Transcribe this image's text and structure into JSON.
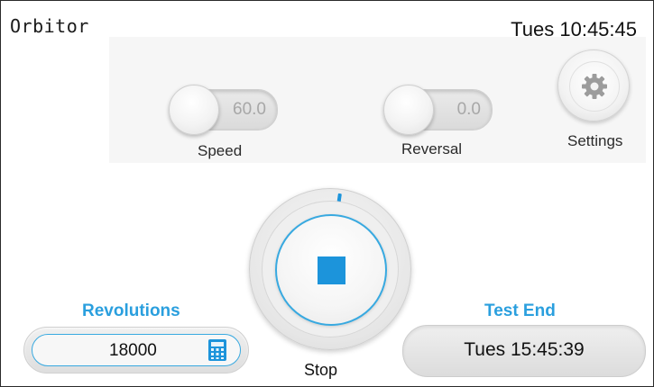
{
  "header": {
    "app_title": "Orbitor",
    "clock": "Tues 10:45:45"
  },
  "controls": {
    "speed": {
      "value": "60.0",
      "label": "Speed"
    },
    "reversal": {
      "value": "0.0",
      "label": "Reversal"
    },
    "settings": {
      "label": "Settings",
      "icon": "gear-icon"
    }
  },
  "stop": {
    "label": "Stop",
    "icon": "stop-icon",
    "accent": "#1c94db"
  },
  "revolutions": {
    "label": "Revolutions",
    "value": "18000",
    "icon": "calculator-icon"
  },
  "test_end": {
    "label": "Test End",
    "value": "Tues 15:45:39"
  }
}
